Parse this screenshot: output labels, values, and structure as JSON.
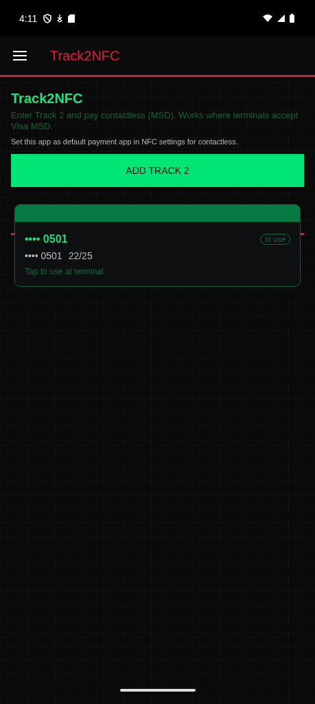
{
  "status_bar": {
    "time": "4:11"
  },
  "toolbar": {
    "title": "Track2NFC"
  },
  "header": {
    "title": "Track2NFC",
    "description": "Enter Track 2 and pay contactless (MSD). Works where terminals accept Visa MSD.",
    "note": "Set this app as default payment app in NFC settings for contactless."
  },
  "add_button": "ADD TRACK 2",
  "cards": [
    {
      "title": "•••• 0501",
      "number": "•••• 0501",
      "expiry": "22/25",
      "hint": "Tap to use at terminal",
      "badge": "In use"
    }
  ]
}
